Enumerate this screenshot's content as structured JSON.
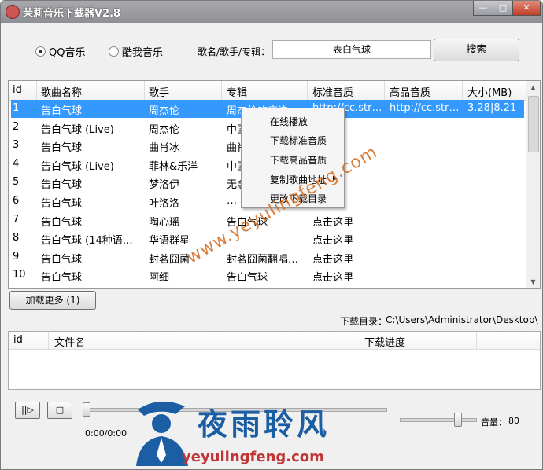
{
  "window": {
    "title": "茉莉音乐下载器V2.8",
    "minimize": "—",
    "maximize": "□",
    "close": "✕"
  },
  "source": {
    "options": [
      "QQ音乐",
      "酷我音乐"
    ],
    "selected": "QQ音乐"
  },
  "search": {
    "label": "歌名/歌手/专辑：",
    "value": "表白气球",
    "button": "搜索"
  },
  "results": {
    "columns": [
      "id",
      "歌曲名称",
      "歌手",
      "专辑",
      "标准音质",
      "高品音质",
      "大小(MB)"
    ],
    "rows": [
      {
        "id": "1",
        "name": "告白气球",
        "artist": "周杰伦",
        "album": "周杰伦的床边…",
        "standard": "http://cc.str…",
        "high": "http://cc.str…",
        "size": "3.28|8.21"
      },
      {
        "id": "2",
        "name": "告白气球 (Live)",
        "artist": "周杰伦",
        "album": "中国…",
        "standard": "",
        "high": "",
        "size": ""
      },
      {
        "id": "3",
        "name": "告白气球",
        "artist": "曲肖冰",
        "album": "曲肖…",
        "standard": "",
        "high": "",
        "size": ""
      },
      {
        "id": "4",
        "name": "告白气球 (Live)",
        "artist": "菲林&乐洋",
        "album": "中国…",
        "standard": "",
        "high": "",
        "size": ""
      },
      {
        "id": "5",
        "name": "告白气球",
        "artist": "梦洛伊",
        "album": "无念…",
        "standard": "",
        "high": "",
        "size": ""
      },
      {
        "id": "6",
        "name": "告白气球",
        "artist": "叶洛洛",
        "album": "…",
        "standard": "",
        "high": "",
        "size": ""
      },
      {
        "id": "7",
        "name": "告白气球",
        "artist": "陶心瑶",
        "album": "告白气球",
        "standard": "点击这里",
        "high": "",
        "size": ""
      },
      {
        "id": "8",
        "name": "告白气球 (14种语…",
        "artist": "华语群星",
        "album": "",
        "standard": "点击这里",
        "high": "",
        "size": ""
      },
      {
        "id": "9",
        "name": "告白气球",
        "artist": "封茗囧菌",
        "album": "封茗囧菌翻唱…",
        "standard": "点击这里",
        "high": "",
        "size": ""
      },
      {
        "id": "10",
        "name": "告白气球",
        "artist": "阿细",
        "album": "告白气球",
        "standard": "点击这里",
        "high": "",
        "size": ""
      }
    ]
  },
  "context_menu": {
    "items": [
      "在线播放",
      "下载标准音质",
      "下载高品音质",
      "复制歌曲地址",
      "更改下载目录"
    ]
  },
  "load_more": "加载更多 (1)",
  "download_dir": {
    "label": "下载目录：",
    "path": "C:\\Users\\Administrator\\Desktop\\"
  },
  "downloads": {
    "columns": [
      "id",
      "文件名",
      "下载进度"
    ]
  },
  "player": {
    "play": "||▷",
    "stop": "□",
    "time": "0:00/0:00",
    "volume_label": "音量：",
    "volume": "80",
    "progress": 0,
    "volume_level": 0.8
  },
  "watermark": {
    "url": "www.yeyulingfeng.com",
    "name": "夜雨聆风",
    "domain": "yeyulingfeng.com"
  }
}
